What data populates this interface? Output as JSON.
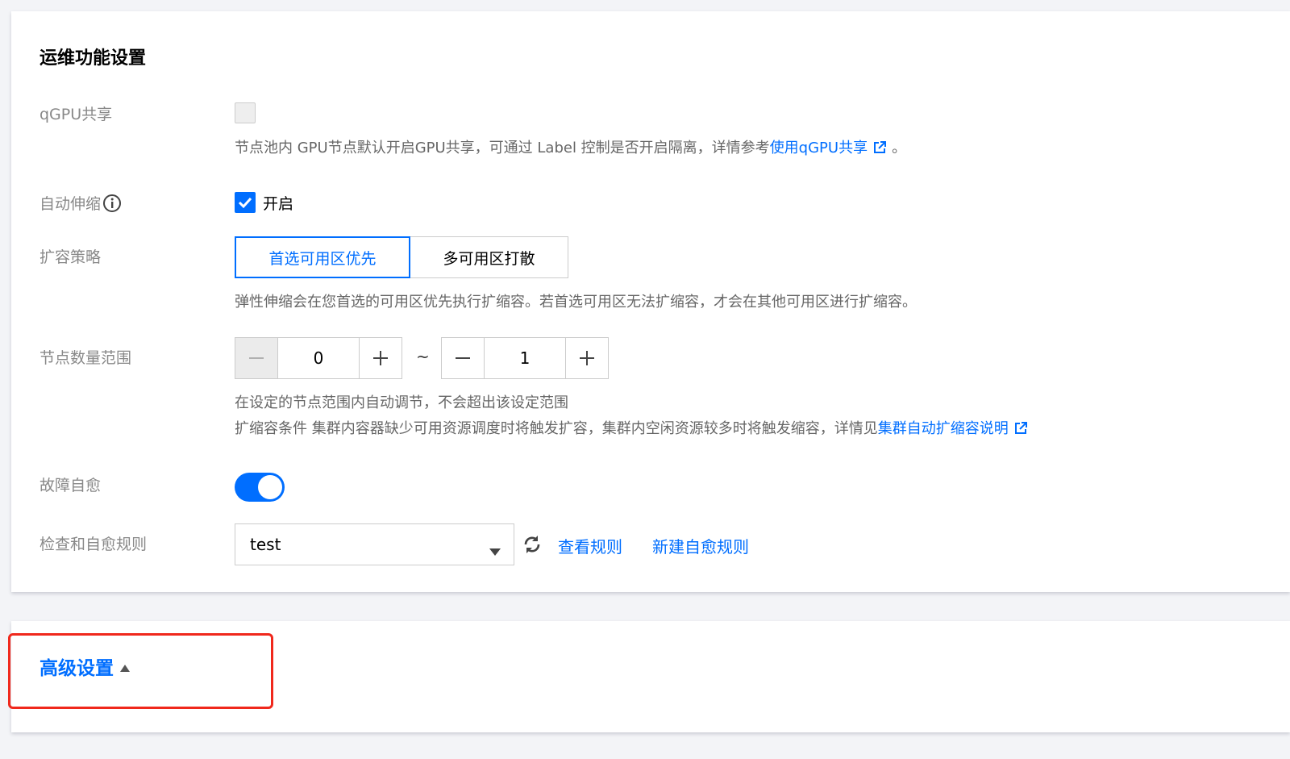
{
  "ops": {
    "title": "运维功能设置",
    "qgpu": {
      "label": "qGPU共享",
      "checked": false,
      "desc_text": "节点池内 GPU节点默认开启GPU共享，可通过 Label 控制是否开启隔离，详情参考",
      "desc_link": "使用qGPU共享",
      "desc_suffix": "。"
    },
    "autoscale": {
      "label": "自动伸缩",
      "checked": true,
      "checkbox_text": "开启"
    },
    "strategy": {
      "label": "扩容策略",
      "options": [
        "首选可用区优先",
        "多可用区打散"
      ],
      "selected": "首选可用区优先",
      "desc": "弹性伸缩会在您首选的可用区优先执行扩缩容。若首选可用区无法扩缩容，才会在其他可用区进行扩缩容。"
    },
    "node_range": {
      "label": "节点数量范围",
      "min": "0",
      "max": "1",
      "separator": "~",
      "desc_line1": "在设定的节点范围内自动调节，不会超出该设定范围",
      "desc_line2": "扩缩容条件 集群内容器缺少可用资源调度时将触发扩容，集群内空闲资源较多时将触发缩容，详情见",
      "desc_link": "集群自动扩缩容说明"
    },
    "self_heal": {
      "label": "故障自愈",
      "enabled": true
    },
    "heal_rule": {
      "label": "检查和自愈规则",
      "value": "test",
      "view_link": "查看规则",
      "new_link": "新建自愈规则"
    }
  },
  "advanced": {
    "label": "高级设置"
  },
  "colors": {
    "accent": "#006eff",
    "highlight": "#f0281c"
  }
}
